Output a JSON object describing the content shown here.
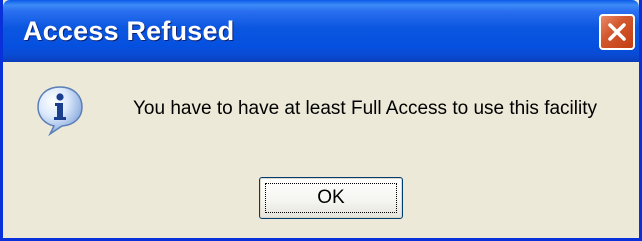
{
  "dialog": {
    "title": "Access Refused",
    "message": "You have to have at least Full Access to use this facility",
    "icon": "info-icon",
    "ok_label": "OK",
    "close_icon": "close-icon"
  },
  "colors": {
    "titlebar_blue": "#0b56e0",
    "border_blue": "#0831d9",
    "close_red": "#d4582f",
    "dialog_background": "#ece9d8"
  }
}
